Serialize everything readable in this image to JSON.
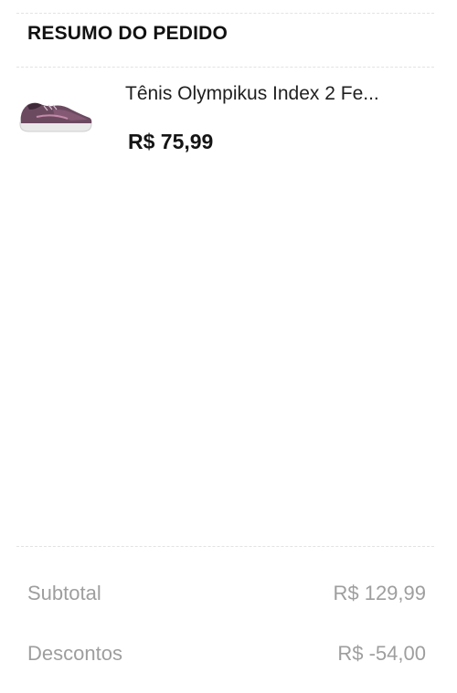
{
  "summary": {
    "title": "RESUMO DO PEDIDO"
  },
  "item": {
    "name": "Tênis Olympikus Index 2 Fe...",
    "price": "R$ 75,99",
    "image_icon": "sneaker-thumbnail"
  },
  "totals": {
    "subtotal_label": "Subtotal",
    "subtotal_value": "R$ 129,99",
    "discount_label": "Descontos",
    "discount_value": "R$ -54,00"
  },
  "colors": {
    "shoe_upper": "#6b4a60",
    "shoe_sole": "#e8e8e8",
    "muted_text": "#9e9e9e"
  }
}
